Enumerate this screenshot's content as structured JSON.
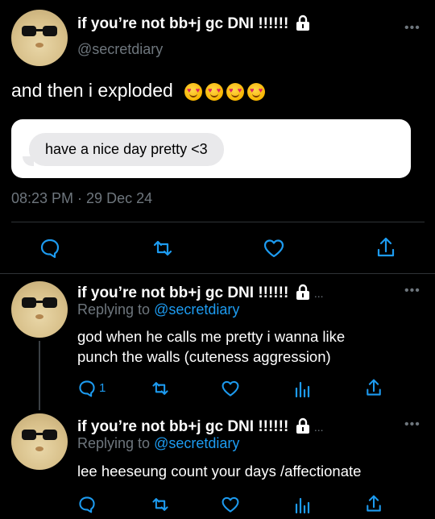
{
  "tweet": {
    "display_name": "if you’re not bb+j gc DNI !!!!!!",
    "handle": "@secretdiary",
    "text": "and then i exploded",
    "emoji": [
      "heart-eyes-emoji",
      "heart-eyes-emoji",
      "heart-eyes-emoji",
      "heart-eyes-emoji"
    ],
    "embedded_message": "have a nice day pretty <3",
    "timestamp": "08:23 PM · 29 Dec 24"
  },
  "replies": [
    {
      "display_name": "if you’re not bb+j gc DNI !!!!!!",
      "replying_prefix": "Replying to ",
      "replying_to": "@secretdiary",
      "text_line1": "god when he calls me pretty i wanna like",
      "text_line2": "punch the walls (cuteness aggression)",
      "reply_count": "1"
    },
    {
      "display_name": "if you’re not bb+j gc DNI !!!!!!",
      "replying_prefix": "Replying to ",
      "replying_to": "@secretdiary",
      "text_line1": "lee heeseung count your days /affectionate"
    }
  ],
  "more_glyph": "•••",
  "ellipsis": "...",
  "colors": {
    "background": "#000000",
    "text": "#ffffff",
    "muted": "#6e767d",
    "link": "#1d9bf0",
    "bubble": "#e9e9eb",
    "divider": "#2f3336"
  }
}
